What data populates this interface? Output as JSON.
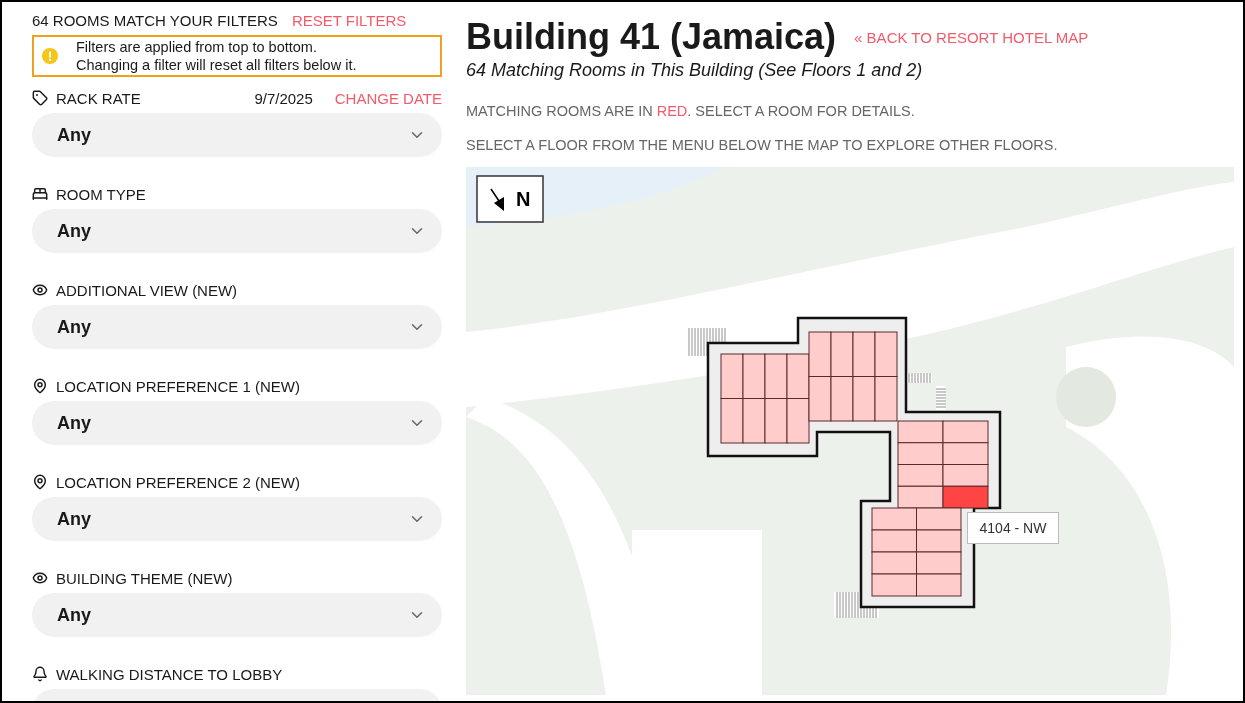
{
  "sidebar": {
    "match_count": "64 ROOMS MATCH YOUR FILTERS",
    "reset_link": "RESET FILTERS",
    "notice": {
      "lines": [
        "Filters are applied from top to bottom.",
        "Changing a filter will reset all filters below it."
      ]
    },
    "filters": [
      {
        "kind": "tag",
        "label": "RACK RATE",
        "date": "9/7/2025",
        "date_link": "CHANGE DATE",
        "value": "Any"
      },
      {
        "kind": "bed",
        "label": "ROOM TYPE",
        "value": "Any"
      },
      {
        "kind": "eye",
        "label": "ADDITIONAL VIEW (NEW)",
        "value": "Any"
      },
      {
        "kind": "pin",
        "label": "LOCATION PREFERENCE 1 (NEW)",
        "value": "Any"
      },
      {
        "kind": "pin",
        "label": "LOCATION PREFERENCE 2 (NEW)",
        "value": "Any"
      },
      {
        "kind": "eye",
        "label": "BUILDING THEME (NEW)",
        "value": "Any"
      },
      {
        "kind": "bell",
        "label": "WALKING DISTANCE TO LOBBY"
      }
    ]
  },
  "main": {
    "title": "Building 41 (Jamaica)",
    "back_link": "« BACK TO RESORT HOTEL MAP",
    "subtitle": "64 Matching Rooms in This Building (See Floors 1 and 2)",
    "instructions": [
      [
        {
          "text": "MATCHING ROOMS ARE IN "
        },
        {
          "text": "RED",
          "kind": "highlight"
        },
        {
          "text": ". SELECT A ROOM FOR DETAILS."
        }
      ],
      [
        {
          "text": "SELECT A FLOOR FROM THE MENU BELOW THE MAP TO EXPLORE OTHER FLOORS."
        }
      ]
    ],
    "map": {
      "compass_label": "N",
      "tooltip": "4104 - NW",
      "wings": [
        {
          "rooms": [
            {
              "selected": false
            },
            {
              "selected": false
            },
            {
              "selected": false
            },
            {
              "selected": false
            },
            {
              "selected": false
            },
            {
              "selected": false
            },
            {
              "selected": false
            },
            {
              "selected": false
            }
          ]
        },
        {
          "rooms": [
            {
              "selected": false
            },
            {
              "selected": false
            },
            {
              "selected": false
            },
            {
              "selected": false
            },
            {
              "selected": false
            },
            {
              "selected": false
            },
            {
              "selected": false
            },
            {
              "selected": false
            }
          ]
        },
        {
          "rooms": [
            {
              "selected": false
            },
            {
              "selected": false
            },
            {
              "selected": false
            },
            {
              "selected": false
            },
            {
              "selected": false
            },
            {
              "selected": false
            },
            {
              "selected": false
            },
            {
              "selected": true
            }
          ]
        },
        {
          "rooms": [
            {
              "selected": false
            },
            {
              "selected": false
            },
            {
              "selected": false
            },
            {
              "selected": false
            },
            {
              "selected": false
            },
            {
              "selected": false
            },
            {
              "selected": false
            },
            {
              "selected": false
            }
          ]
        }
      ]
    }
  }
}
